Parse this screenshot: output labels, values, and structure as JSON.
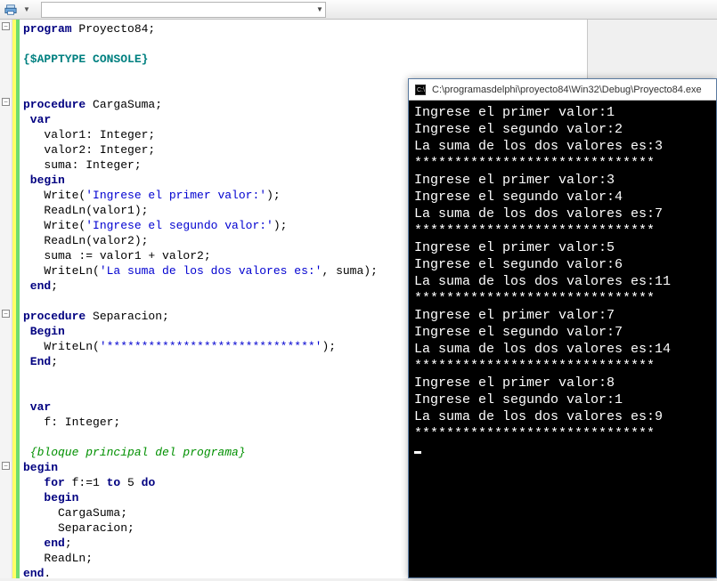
{
  "toolbar": {
    "printer_icon": "printer-icon",
    "dropdown_selected": ""
  },
  "code": {
    "l1_kw": "program",
    "l1_id": " Proyecto84;",
    "l3_dir": "{$APPTYPE CONSOLE}",
    "l6_kw": "procedure",
    "l6_id": " CargaSuma;",
    "l7_kw": " var",
    "l8": "   valor1: Integer;",
    "l9": "   valor2: Integer;",
    "l10": "   suma: Integer;",
    "l11_kw": " begin",
    "l12a": "   Write(",
    "l12s": "'Ingrese el primer valor:'",
    "l12b": ");",
    "l13": "   ReadLn(valor1);",
    "l14a": "   Write(",
    "l14s": "'Ingrese el segundo valor:'",
    "l14b": ");",
    "l15": "   ReadLn(valor2);",
    "l16": "   suma := valor1 + valor2;",
    "l17a": "   WriteLn(",
    "l17s": "'La suma de los dos valores es:'",
    "l17b": ", suma);",
    "l18_kw": " end",
    "l18b": ";",
    "l20_kw": "procedure",
    "l20_id": " Separacion;",
    "l21_kw": " Begin",
    "l22a": "   WriteLn(",
    "l22s": "'******************************'",
    "l22b": ");",
    "l23_kw": " End",
    "l23b": ";",
    "l26_kw": " var",
    "l27": "   f: Integer;",
    "l29_cmt": " {bloque principal del programa}",
    "l30_kw": "begin",
    "l31a": "   ",
    "l31_kw": "for",
    "l31b": " f:=1 ",
    "l31_kw2": "to",
    "l31c": " 5 ",
    "l31_kw3": "do",
    "l32_kw": "   begin",
    "l33": "     CargaSuma;",
    "l34": "     Separacion;",
    "l35_kw": "   end",
    "l35b": ";",
    "l36": "   ReadLn;",
    "l37_kw": "end",
    "l37b": "."
  },
  "console": {
    "title": "C:\\programasdelphi\\proyecto84\\Win32\\Debug\\Proyecto84.exe",
    "runs": [
      {
        "p1": "Ingrese el primer valor:1",
        "p2": "Ingrese el segundo valor:2",
        "sum": "La suma de los dos valores es:3",
        "sep": "******************************"
      },
      {
        "p1": "Ingrese el primer valor:3",
        "p2": "Ingrese el segundo valor:4",
        "sum": "La suma de los dos valores es:7",
        "sep": "******************************"
      },
      {
        "p1": "Ingrese el primer valor:5",
        "p2": "Ingrese el segundo valor:6",
        "sum": "La suma de los dos valores es:11",
        "sep": "******************************"
      },
      {
        "p1": "Ingrese el primer valor:7",
        "p2": "Ingrese el segundo valor:7",
        "sum": "La suma de los dos valores es:14",
        "sep": "******************************"
      },
      {
        "p1": "Ingrese el primer valor:8",
        "p2": "Ingrese el segundo valor:1",
        "sum": "La suma de los dos valores es:9",
        "sep": "******************************"
      }
    ]
  }
}
